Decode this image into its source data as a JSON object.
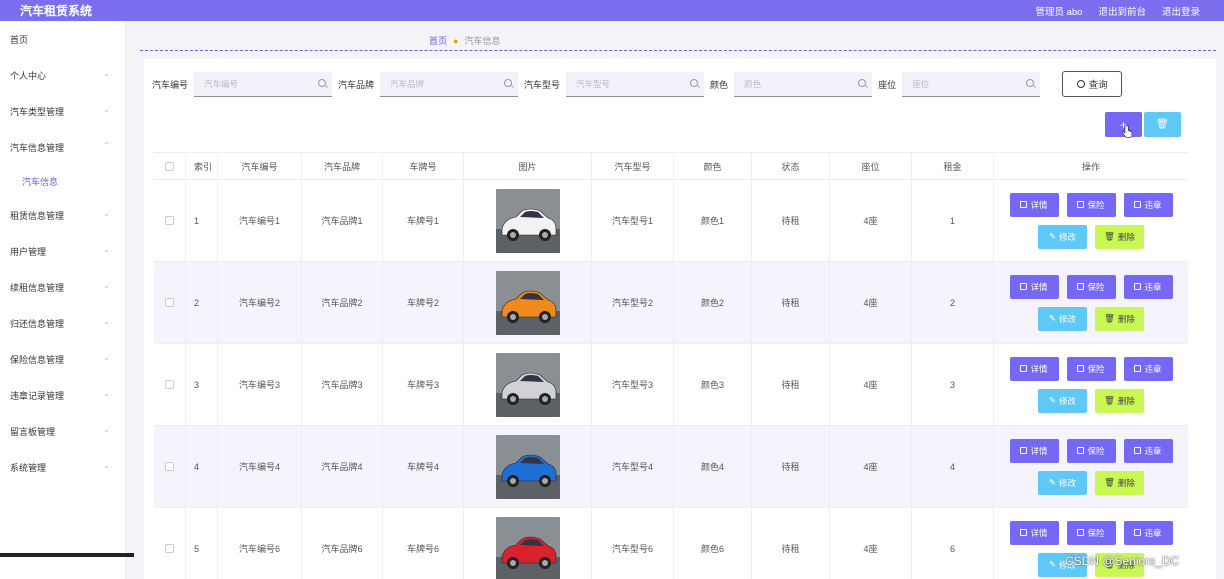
{
  "app": {
    "title": "汽车租赁系统",
    "admin": "管理员 abo",
    "front": "退出到前台",
    "logout": "退出登录"
  },
  "sidebar": {
    "items": [
      {
        "label": "首页",
        "chev": false
      },
      {
        "label": "个人中心",
        "chev": true
      },
      {
        "label": "汽车类型管理",
        "chev": true
      },
      {
        "label": "汽车信息管理",
        "chev": true,
        "open": true
      },
      {
        "label": "租赁信息管理",
        "chev": true
      },
      {
        "label": "用户管理",
        "chev": true
      },
      {
        "label": "续租信息管理",
        "chev": true
      },
      {
        "label": "归还信息管理",
        "chev": true
      },
      {
        "label": "保险信息管理",
        "chev": true
      },
      {
        "label": "违章记录管理",
        "chev": true
      },
      {
        "label": "留言板管理",
        "chev": true
      },
      {
        "label": "系统管理",
        "chev": true
      }
    ],
    "sub_active": "汽车信息"
  },
  "breadcrumb": {
    "home": "首页",
    "current": "汽车信息"
  },
  "search": {
    "fields": [
      {
        "label": "汽车编号",
        "placeholder": "汽车编号"
      },
      {
        "label": "汽车品牌",
        "placeholder": "汽车品牌"
      },
      {
        "label": "汽车型号",
        "placeholder": "汽车型号"
      },
      {
        "label": "颜色",
        "placeholder": "颜色"
      },
      {
        "label": "座位",
        "placeholder": "座位"
      }
    ],
    "query": "查询"
  },
  "toolbar": {
    "add": "+",
    "delete": "🗑"
  },
  "table": {
    "headers": [
      "索引",
      "汽车编号",
      "汽车品牌",
      "车牌号",
      "图片",
      "汽车型号",
      "颜色",
      "状态",
      "座位",
      "租金",
      "操作"
    ],
    "rows": [
      {
        "idx": "1",
        "no": "汽车编号1",
        "brand": "汽车品牌1",
        "plate": "车牌号1",
        "model": "汽车型号1",
        "color": "颜色1",
        "status": "待租",
        "seat": "4座",
        "rent": "1",
        "car_color": "#f2f2f2"
      },
      {
        "idx": "2",
        "no": "汽车编号2",
        "brand": "汽车品牌2",
        "plate": "车牌号2",
        "model": "汽车型号2",
        "color": "颜色2",
        "status": "待租",
        "seat": "4座",
        "rent": "2",
        "car_color": "#f08a1e"
      },
      {
        "idx": "3",
        "no": "汽车编号3",
        "brand": "汽车品牌3",
        "plate": "车牌号3",
        "model": "汽车型号3",
        "color": "颜色3",
        "status": "待租",
        "seat": "4座",
        "rent": "3",
        "car_color": "#cfd2d6"
      },
      {
        "idx": "4",
        "no": "汽车编号4",
        "brand": "汽车品牌4",
        "plate": "车牌号4",
        "model": "汽车型号4",
        "color": "颜色4",
        "status": "待租",
        "seat": "4座",
        "rent": "4",
        "car_color": "#1f6fd6"
      },
      {
        "idx": "5",
        "no": "汽车编号6",
        "brand": "汽车品牌6",
        "plate": "车牌号6",
        "model": "汽车型号6",
        "color": "颜色6",
        "status": "待租",
        "seat": "4座",
        "rent": "6",
        "car_color": "#d8232d"
      }
    ],
    "ops": {
      "detail": "详情",
      "insurance": "保险",
      "violation": "违章",
      "edit": "修改",
      "delete": "删除"
    }
  },
  "watermark": "CSDN @Seniors_DC"
}
